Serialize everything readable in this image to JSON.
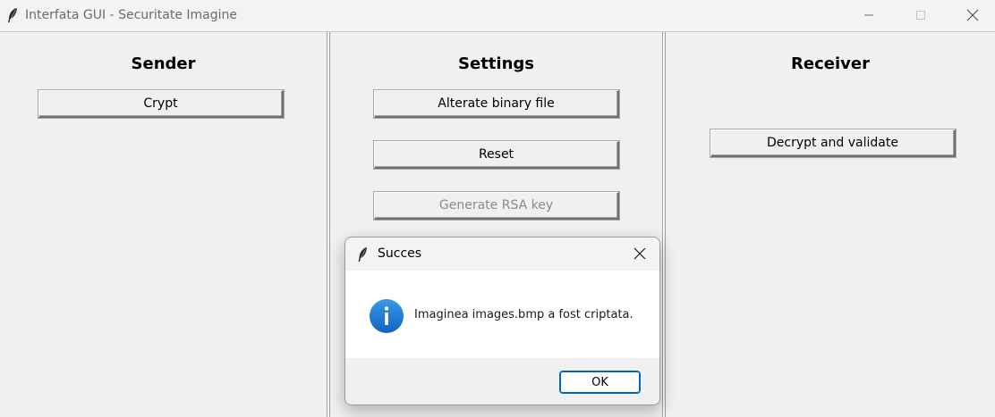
{
  "window": {
    "title": "Interfata GUI - Securitate Imagine"
  },
  "sender": {
    "title": "Sender",
    "crypt_label": "Crypt"
  },
  "settings": {
    "title": "Settings",
    "alterate_label": "Alterate binary file",
    "reset_label": "Reset",
    "generate_rsa_label": "Generate RSA key"
  },
  "receiver": {
    "title": "Receiver",
    "decrypt_label": "Decrypt and validate"
  },
  "dialog": {
    "title": "Succes",
    "message": "Imaginea images.bmp a fost criptata.",
    "ok_label": "OK",
    "icon": "info-icon"
  },
  "colors": {
    "info_blue": "#1a78d4",
    "ok_border": "#0067c0",
    "window_bg": "#f0f0f0"
  }
}
